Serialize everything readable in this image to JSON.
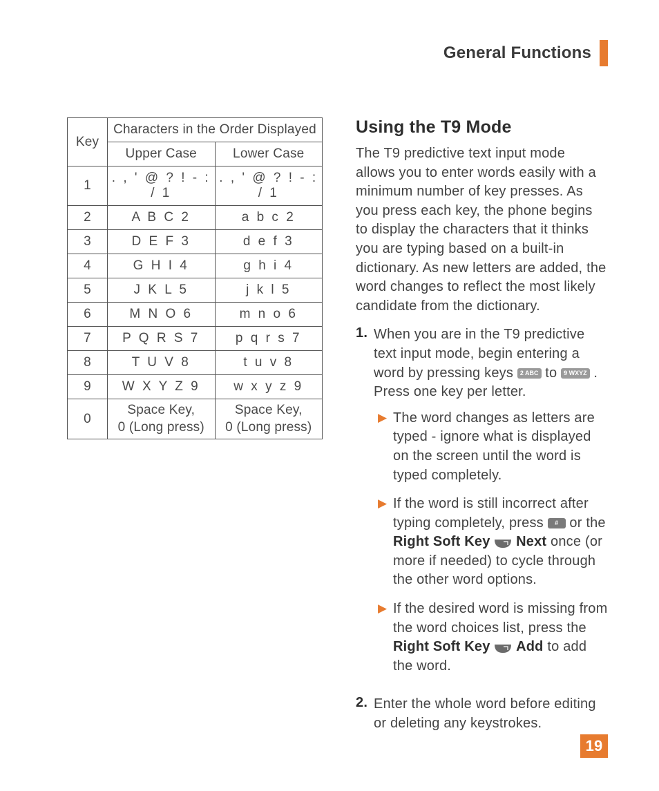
{
  "header": {
    "title": "General Functions"
  },
  "table": {
    "head_key": "Key",
    "head_chars": "Characters in the Order Displayed",
    "head_upper": "Upper Case",
    "head_lower": "Lower Case",
    "rows": [
      {
        "key": "1",
        "upper": ". , ' @ ? ! - : / 1",
        "lower": ". , ' @ ? ! - : / 1"
      },
      {
        "key": "2",
        "upper": "A B C 2",
        "lower": "a b c 2"
      },
      {
        "key": "3",
        "upper": "D E F 3",
        "lower": "d e f 3"
      },
      {
        "key": "4",
        "upper": "G H I 4",
        "lower": "g h i 4"
      },
      {
        "key": "5",
        "upper": "J K L 5",
        "lower": "j k l 5"
      },
      {
        "key": "6",
        "upper": "M N O 6",
        "lower": "m n o 6"
      },
      {
        "key": "7",
        "upper": "P Q R S 7",
        "lower": "p q r s 7"
      },
      {
        "key": "8",
        "upper": "T U V 8",
        "lower": "t u v 8"
      },
      {
        "key": "9",
        "upper": "W X Y Z 9",
        "lower": "w x y z 9"
      },
      {
        "key": "0",
        "upper": "Space Key,\n0 (Long press)",
        "lower": "Space Key,\n0 (Long press)"
      }
    ]
  },
  "section": {
    "heading": "Using the T9 Mode",
    "intro": "The T9 predictive text input mode allows you to enter words easily with a minimum number of key presses. As you press each key, the phone begins to display the characters that it thinks you are typing based on a built-in dictionary. As new letters are added, the word changes to reflect the most likely candidate from the dictionary.",
    "step1_a": "When you are in the T9 predictive text input mode, begin entering a word by pressing keys ",
    "step1_key2": "2 ABC",
    "step1_to": " to ",
    "step1_key9": "9 WXYZ",
    "step1_b": ". Press one key per letter.",
    "bullet1": "The word changes as letters are typed - ignore what is displayed on the screen until the word is typed completely.",
    "bullet2_a": "If the word is still incorrect after typing completely, press ",
    "bullet2_hash": "#",
    "bullet2_b": " or the ",
    "bullet2_rsk": "Right Soft Key",
    "bullet2_next": " Next",
    "bullet2_c": " once (or more if needed) to cycle through the other word options.",
    "bullet3_a": "If the desired word is missing from the word choices list, press the ",
    "bullet3_rsk": "Right Soft Key",
    "bullet3_add": " Add",
    "bullet3_b": " to add the word.",
    "step2": "Enter the whole word before editing or deleting any keystrokes."
  },
  "page_number": "19"
}
